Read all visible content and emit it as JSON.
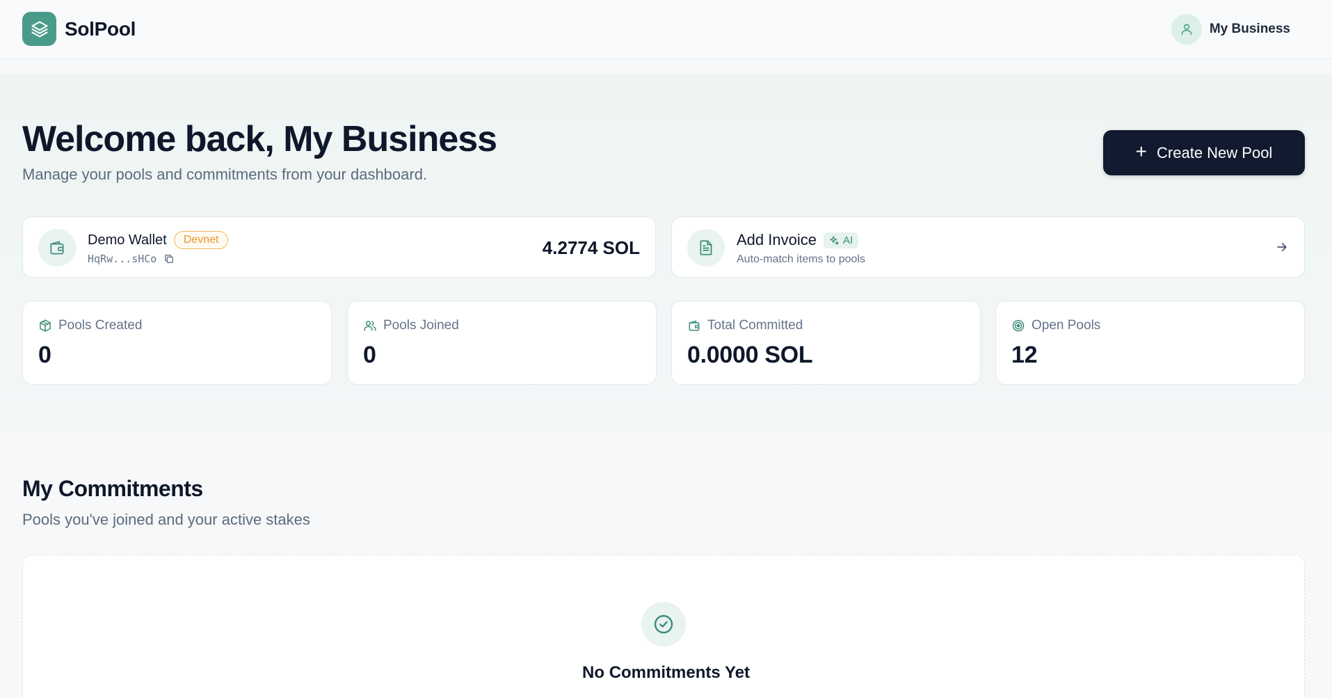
{
  "app": {
    "name": "SolPool",
    "account_name": "My Business"
  },
  "hero": {
    "title": "Welcome back, My Business",
    "subtitle": "Manage your pools and commitments from your dashboard.",
    "create_button_label": "Create New Pool"
  },
  "wallet": {
    "name": "Demo Wallet",
    "network_badge": "Devnet",
    "address": "HqRw...sHCo",
    "balance": "4.2774 SOL"
  },
  "invoice": {
    "title": "Add Invoice",
    "badge": "AI",
    "subtitle": "Auto-match items to pools"
  },
  "stats": [
    {
      "label": "Pools Created",
      "value": "0",
      "icon": "package-icon"
    },
    {
      "label": "Pools Joined",
      "value": "0",
      "icon": "users-icon"
    },
    {
      "label": "Total Committed",
      "value": "0.0000 SOL",
      "icon": "wallet-icon"
    },
    {
      "label": "Open Pools",
      "value": "12",
      "icon": "target-icon"
    }
  ],
  "commitments": {
    "title": "My Commitments",
    "subtitle": "Pools you've joined and your active stakes",
    "empty_title": "No Commitments Yet"
  },
  "colors": {
    "brand": "#4a9a8a",
    "primary_button": "#111a2e",
    "devnet_badge": "#e59a2e",
    "icon_teal": "#3e8c7b"
  }
}
